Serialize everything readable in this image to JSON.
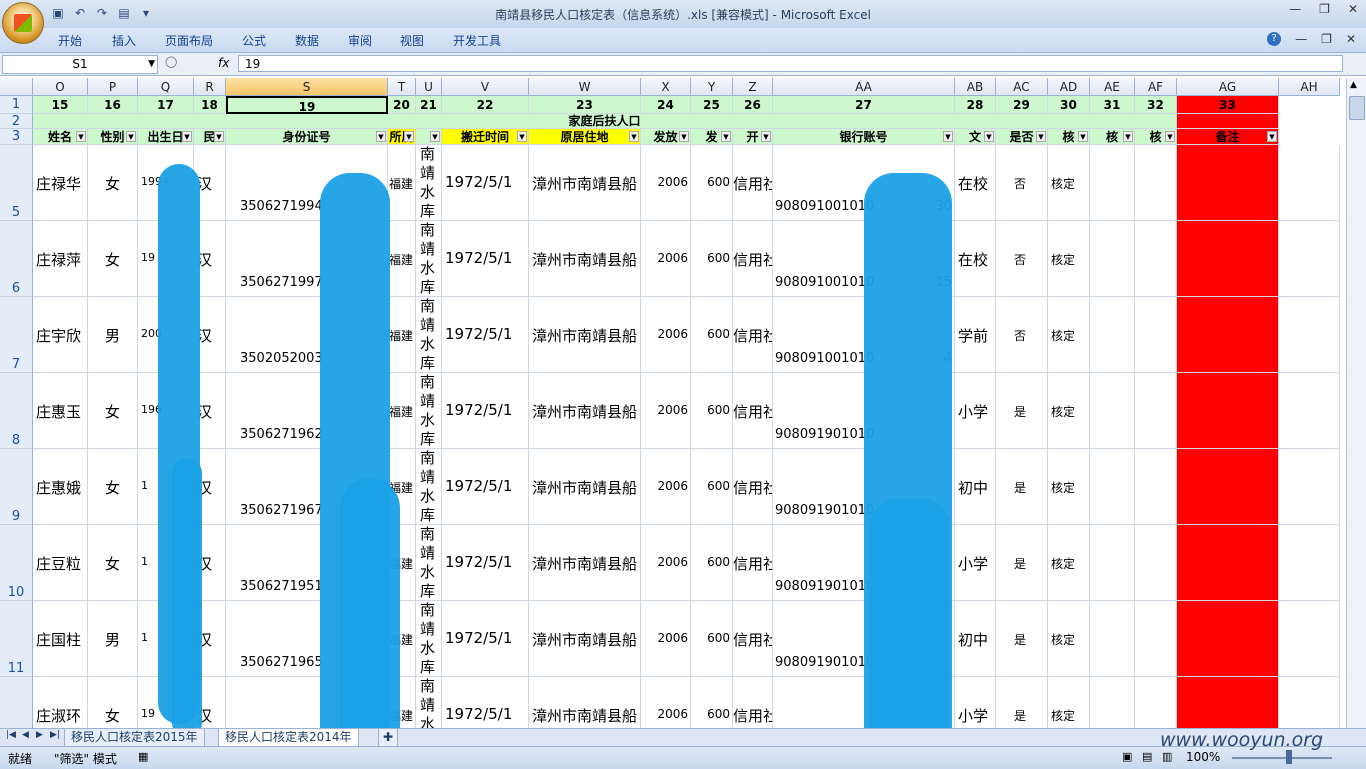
{
  "window": {
    "title": "南靖县移民人口核定表（信息系统）.xls  [兼容模式] - Microsoft Excel"
  },
  "ribbon": {
    "tabs": [
      "开始",
      "插入",
      "页面布局",
      "公式",
      "数据",
      "审阅",
      "视图",
      "开发工具"
    ]
  },
  "formula_bar": {
    "name_box": "S1",
    "fx": "fx",
    "formula": "19"
  },
  "columns": [
    {
      "letter": "O",
      "num": "15",
      "header": "姓名"
    },
    {
      "letter": "P",
      "num": "16",
      "header": "性别"
    },
    {
      "letter": "Q",
      "num": "17",
      "header": "出生日"
    },
    {
      "letter": "R",
      "num": "18",
      "header": "民"
    },
    {
      "letter": "S",
      "num": "19",
      "header": "身份证号"
    },
    {
      "letter": "T",
      "num": "20",
      "header": "所属"
    },
    {
      "letter": "U",
      "num": "21",
      "header": ""
    },
    {
      "letter": "V",
      "num": "22",
      "header": "搬迁时间"
    },
    {
      "letter": "W",
      "num": "23",
      "header": "原居住地"
    },
    {
      "letter": "X",
      "num": "24",
      "header": "发放"
    },
    {
      "letter": "Y",
      "num": "25",
      "header": "发"
    },
    {
      "letter": "Z",
      "num": "26",
      "header": "开"
    },
    {
      "letter": "AA",
      "num": "27",
      "header": "银行账号"
    },
    {
      "letter": "AB",
      "num": "28",
      "header": "文"
    },
    {
      "letter": "AC",
      "num": "29",
      "header": "是否"
    },
    {
      "letter": "AD",
      "num": "30",
      "header": "核"
    },
    {
      "letter": "AE",
      "num": "31",
      "header": "核"
    },
    {
      "letter": "AF",
      "num": "32",
      "header": "核"
    },
    {
      "letter": "AG",
      "num": "33",
      "header": "备注"
    },
    {
      "letter": "AH",
      "num": "",
      "header": ""
    }
  ],
  "group_header": "家庭后扶人口",
  "rows": [
    {
      "n": "5",
      "name": "庄禄华",
      "sex": "女",
      "birth": "1994",
      "eth": "汉",
      "id": "3506271994",
      "prov": "福建",
      "res": [
        "南",
        "靖",
        "水",
        "库"
      ],
      "move": "1972/5/1",
      "orig": "漳州市南靖县船",
      "year": "2006",
      "amt": "600",
      "bank": "信用社",
      "acct": "908091001010",
      "acct_tail": "30",
      "edu": "在校",
      "flag": "否",
      "chk": "核定"
    },
    {
      "n": "6",
      "name": "庄禄萍",
      "sex": "女",
      "birth": "19",
      "eth": "汉",
      "id": "3506271997",
      "prov": "福建",
      "res": [
        "南",
        "靖",
        "水",
        "库"
      ],
      "move": "1972/5/1",
      "orig": "漳州市南靖县船",
      "year": "2006",
      "amt": "600",
      "bank": "信用社",
      "acct": "908091001010",
      "acct_tail": "15",
      "edu": "在校",
      "flag": "否",
      "chk": "核定"
    },
    {
      "n": "7",
      "name": "庄宇欣",
      "sex": "男",
      "birth": "200",
      "eth": "汉",
      "id": "3502052003",
      "prov": "福建",
      "res": [
        "南",
        "靖",
        "水",
        "库"
      ],
      "move": "1972/5/1",
      "orig": "漳州市南靖县船",
      "year": "2006",
      "amt": "600",
      "bank": "信用社",
      "acct": "908091001010",
      "acct_tail": "4",
      "edu": "学前",
      "flag": "否",
      "chk": "核定"
    },
    {
      "n": "8",
      "name": "庄惠玉",
      "sex": "女",
      "birth": "196",
      "eth": "汉",
      "id": "3506271962",
      "prov": "福建",
      "res": [
        "南",
        "靖",
        "水",
        "库"
      ],
      "move": "1972/5/1",
      "orig": "漳州市南靖县船",
      "year": "2006",
      "amt": "600",
      "bank": "信用社",
      "acct": "908091901010",
      "acct_tail": "",
      "edu": "小学",
      "flag": "是",
      "chk": "核定"
    },
    {
      "n": "9",
      "name": "庄惠娥",
      "sex": "女",
      "birth": "1",
      "eth": "汉",
      "id": "3506271967",
      "prov": "福建",
      "res": [
        "南",
        "靖",
        "水",
        "库"
      ],
      "move": "1972/5/1",
      "orig": "漳州市南靖县船",
      "year": "2006",
      "amt": "600",
      "bank": "信用社",
      "acct": "908091901010",
      "acct_tail": "",
      "edu": "初中",
      "flag": "是",
      "chk": "核定"
    },
    {
      "n": "10",
      "name": "庄豆粒",
      "sex": "女",
      "birth": "1",
      "eth": "汉",
      "id": "3506271951",
      "prov": "福建",
      "res": [
        "南",
        "靖",
        "水",
        "库"
      ],
      "move": "1972/5/1",
      "orig": "漳州市南靖县船",
      "year": "2006",
      "amt": "600",
      "bank": "信用社",
      "acct": "908091901010",
      "acct_tail": "",
      "edu": "小学",
      "flag": "是",
      "chk": "核定"
    },
    {
      "n": "11",
      "name": "庄国柱",
      "sex": "男",
      "birth": "1",
      "eth": "汉",
      "id": "3506271965",
      "prov": "福建",
      "res": [
        "南",
        "靖",
        "水",
        "库"
      ],
      "move": "1972/5/1",
      "orig": "漳州市南靖县船",
      "year": "2006",
      "amt": "600",
      "bank": "信用社",
      "acct": "908091901010",
      "acct_tail": "",
      "edu": "初中",
      "flag": "是",
      "chk": "核定"
    },
    {
      "n": "",
      "name": "庄淑环",
      "sex": "女",
      "birth": "19",
      "eth": "汉",
      "id": "",
      "prov": "福建",
      "res": [
        "南",
        "靖",
        "水"
      ],
      "move": "1972/5/1",
      "orig": "漳州市南靖县船",
      "year": "2006",
      "amt": "600",
      "bank": "信用社",
      "acct": "",
      "acct_tail": "",
      "edu": "小学",
      "flag": "是",
      "chk": "核定"
    }
  ],
  "sheet_tabs": [
    "移民人口核定表2015年",
    "移民人口核定表2014年"
  ],
  "status": {
    "ready": "就绪",
    "mode": "\"筛选\" 模式",
    "zoom": "100%",
    "watermark": "www.wooyun.org"
  }
}
